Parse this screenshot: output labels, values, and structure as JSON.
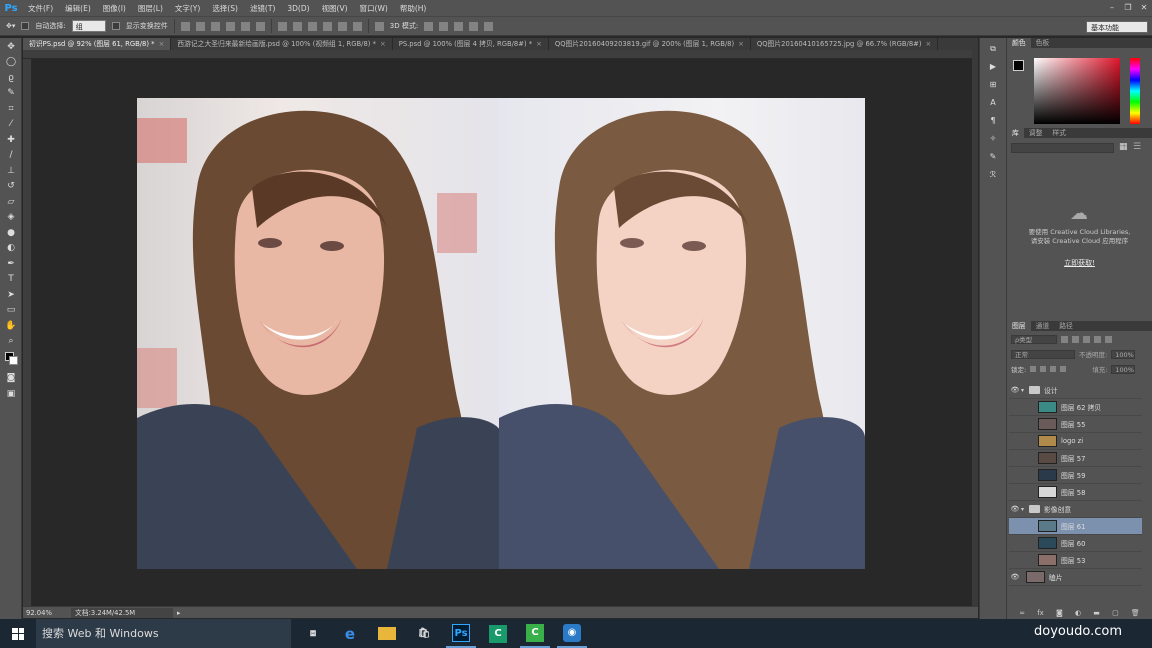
{
  "app": {
    "logo": "Ps"
  },
  "menu": [
    "文件(F)",
    "编辑(E)",
    "图像(I)",
    "图层(L)",
    "文字(Y)",
    "选择(S)",
    "滤镜(T)",
    "3D(D)",
    "视图(V)",
    "窗口(W)",
    "帮助(H)"
  ],
  "window_controls": {
    "minimize": "–",
    "restore": "❐",
    "close": "✕"
  },
  "options": {
    "auto_select_label": "自动选择:",
    "auto_select_value": "组",
    "show_transform_label": "显示变换控件",
    "mode_3d_label": "3D 模式:",
    "workspace": "基本功能"
  },
  "tabs": [
    {
      "label": "初识PS.psd @ 92% (图层 61, RGB/8) *",
      "active": true
    },
    {
      "label": "西游记之大圣归来最新绘画版.psd @ 100% (视频组 1, RGB/8) *",
      "active": false
    },
    {
      "label": "PS.psd @ 100% (图层 4 拷贝, RGB/8#) *",
      "active": false
    },
    {
      "label": "QQ图片20160409203819.gif @ 200% (图层 1, RGB/8)",
      "active": false
    },
    {
      "label": "QQ图片20160410165725.jpg @ 66.7% (RGB/8#)",
      "active": false
    }
  ],
  "status": {
    "zoom": "92.04%",
    "doc": "文档:3.24M/42.5M"
  },
  "color_panel": {
    "tabs": [
      "颜色",
      "色板"
    ]
  },
  "library_panel": {
    "tabs": [
      "库",
      "调整",
      "样式"
    ],
    "message_line1": "要使用 Creative Cloud Libraries,",
    "message_line2": "请安装 Creative Cloud 应用程序",
    "link": "立即获取!"
  },
  "layers_panel": {
    "tabs": [
      "图层",
      "通道",
      "路径"
    ],
    "kind_filter": "ρ类型",
    "blend_mode": "正常",
    "opacity_label": "不透明度:",
    "opacity_value": "100%",
    "lock_label": "锁定:",
    "fill_label": "填充:",
    "fill_value": "100%",
    "layers": [
      {
        "name": "设计",
        "type": "group",
        "visible": true,
        "selected": false
      },
      {
        "name": "图层 62 拷贝",
        "type": "layer",
        "visible": false,
        "selected": false,
        "thumb": "#3c8a86"
      },
      {
        "name": "图层 55",
        "type": "layer",
        "visible": false,
        "selected": false,
        "thumb": "#6a5a58"
      },
      {
        "name": "logo zi",
        "type": "layer",
        "visible": false,
        "selected": false,
        "thumb": "#b08a4a"
      },
      {
        "name": "图层 57",
        "type": "layer",
        "visible": false,
        "selected": false,
        "thumb": "#5a4a44"
      },
      {
        "name": "图层 59",
        "type": "layer",
        "visible": false,
        "selected": false,
        "thumb": "#2a3a4a"
      },
      {
        "name": "图层 58",
        "type": "layer",
        "visible": false,
        "selected": false,
        "thumb": "#d8d8d8"
      },
      {
        "name": "影像创意",
        "type": "group",
        "visible": true,
        "selected": false
      },
      {
        "name": "图层 61",
        "type": "layer",
        "visible": false,
        "selected": true,
        "thumb": "#5a7a8a"
      },
      {
        "name": "图层 60",
        "type": "layer",
        "visible": false,
        "selected": false,
        "thumb": "#2a4a5a"
      },
      {
        "name": "图层 53",
        "type": "layer",
        "visible": false,
        "selected": false,
        "thumb": "#8a7068"
      },
      {
        "name": "瞌片",
        "type": "layer",
        "visible": true,
        "selected": false,
        "thumb": "#7a6a6a"
      }
    ]
  },
  "taskbar": {
    "search_placeholder": "搜索 Web 和 Windows",
    "watermark": "doyoudo.com"
  }
}
